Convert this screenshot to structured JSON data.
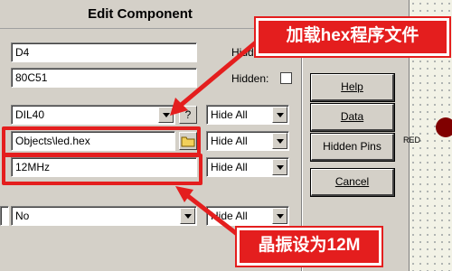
{
  "window": {
    "title": "Edit Component"
  },
  "fields": {
    "part_reference": {
      "value": "D4",
      "hidden_label": "Hidd"
    },
    "part_value": {
      "value": "80C51",
      "hidden_label": "Hidden:"
    },
    "pcb_package": {
      "value": "DIL40",
      "help_button": "?",
      "visibility": "Hide All"
    },
    "program_file": {
      "value": "Objects\\led.hex",
      "visibility": "Hide All"
    },
    "clock_frequency": {
      "value": "12MHz",
      "visibility": "Hide All"
    },
    "advanced": {
      "value": "No",
      "visibility": "Hide All"
    }
  },
  "buttons": {
    "help": "Help",
    "data": "Data",
    "hidden_pins": "Hidden Pins",
    "cancel": "Cancel"
  },
  "schematic": {
    "label": "RED"
  },
  "annotations": {
    "load_hex": "加载hex程序文件",
    "crystal": "晶振设为12M"
  },
  "colors": {
    "annotation": "#e41e1e",
    "dialog": "#d4d0c8"
  }
}
